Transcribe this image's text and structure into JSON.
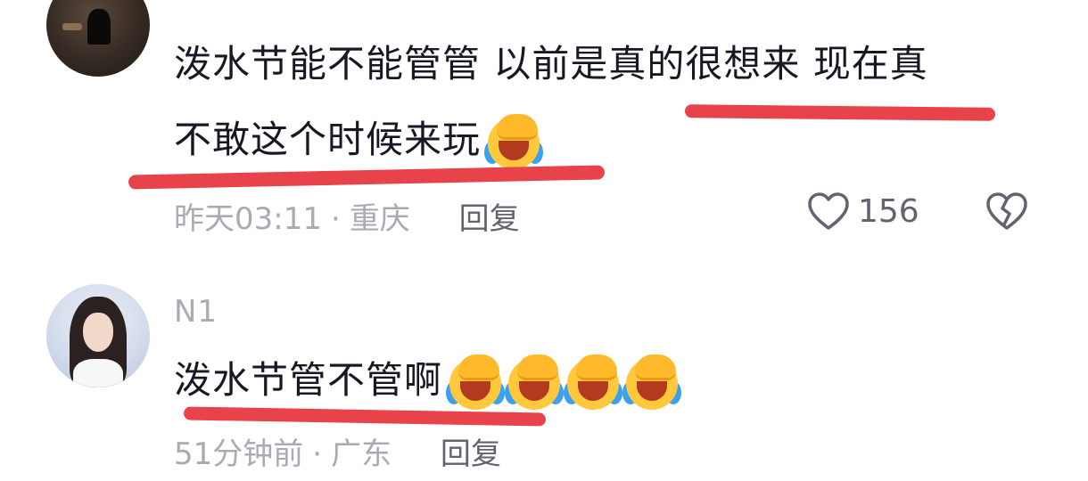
{
  "comments": [
    {
      "username": "",
      "text_line1": "泼水节能不能管管 以前是真的很想来 现在真",
      "text_line2": "不敢这个时候来玩",
      "emoji_count": 1,
      "time": "昨天03:11",
      "location": "重庆",
      "separator": "·",
      "reply_label": "回复",
      "likes": "156"
    },
    {
      "username": "N1",
      "text": "泼水节管不管啊",
      "emoji_count": 4,
      "time": "51分钟前",
      "location": "广东",
      "separator": "·",
      "reply_label": "回复"
    }
  ],
  "icons": {
    "like": "heart-outline-icon",
    "dislike": "broken-heart-icon",
    "emoji": "laughing-crying-emoji-icon"
  },
  "colors": {
    "annotation_underline": "#e8434a",
    "meta_text": "#a8abb3",
    "main_text": "#161823"
  }
}
